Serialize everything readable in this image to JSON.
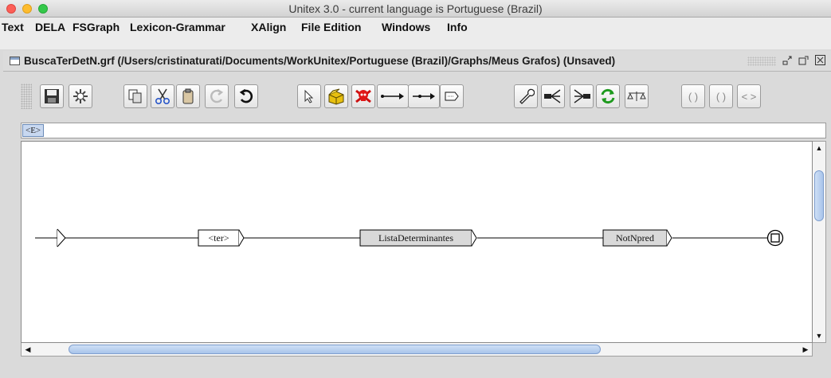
{
  "window": {
    "title": "Unitex 3.0 - current language is Portuguese (Brazil)"
  },
  "menubar": {
    "items": [
      {
        "label": "Text"
      },
      {
        "label": "DELA"
      },
      {
        "label": "FSGraph"
      },
      {
        "label": "Lexicon-Grammar"
      },
      {
        "label": "XAlign"
      },
      {
        "label": "File Edition"
      },
      {
        "label": "Windows"
      },
      {
        "label": "Info"
      }
    ]
  },
  "frame": {
    "title": "BuscaTerDetN.grf (/Users/cristinaturati/Documents/WorkUnitex/Portuguese (Brazil)/Graphs/Meus Grafos) (Unsaved)",
    "controls": [
      "iconify-icon",
      "maximize-icon",
      "close-icon"
    ]
  },
  "toolbar": {
    "buttons": [
      {
        "name": "save-button",
        "icon": "floppy-disk-icon"
      },
      {
        "name": "compile-button",
        "icon": "gear-icon"
      },
      {
        "name": "copy-button",
        "icon": "copy-icon"
      },
      {
        "name": "cut-button",
        "icon": "scissors-icon"
      },
      {
        "name": "paste-button",
        "icon": "clipboard-icon"
      },
      {
        "name": "redo-button",
        "icon": "redo-icon",
        "disabled": true
      },
      {
        "name": "undo-button",
        "icon": "undo-icon"
      },
      {
        "name": "select-tool-button",
        "icon": "arrow-pointer-icon"
      },
      {
        "name": "create-box-button",
        "icon": "open-box-icon"
      },
      {
        "name": "kill-box-button",
        "icon": "skull-icon"
      },
      {
        "name": "link-boxes-button",
        "icon": "link-arrow-icon"
      },
      {
        "name": "reverse-link-button",
        "icon": "reverse-link-icon"
      },
      {
        "name": "open-subgraph-button",
        "icon": "subgraph-box-icon"
      },
      {
        "name": "configure-button",
        "icon": "wrench-icon"
      },
      {
        "name": "align-button",
        "icon": "fork-left-icon"
      },
      {
        "name": "merge-button",
        "icon": "fork-right-icon"
      },
      {
        "name": "refresh-button",
        "icon": "refresh-icon"
      },
      {
        "name": "balance-button",
        "icon": "balance-icon"
      },
      {
        "name": "parens-button-1",
        "label": "( )",
        "disabled": true
      },
      {
        "name": "parens-button-2",
        "label": "( )",
        "disabled": true
      },
      {
        "name": "angle-button",
        "label": "< >",
        "disabled": true
      }
    ]
  },
  "token_strip": {
    "value": "<E>"
  },
  "graph": {
    "boxes": [
      {
        "name": "box-ter",
        "label": "<ter>",
        "subgraph": false
      },
      {
        "name": "box-lista-determinantes",
        "label": "ListaDeterminantes",
        "subgraph": true
      },
      {
        "name": "box-notnpred",
        "label": "NotNpred",
        "subgraph": true
      }
    ],
    "colors": {
      "subgraph_fill": "#d9d9d9",
      "line": "#000000"
    }
  },
  "scrollbars": {
    "vertical": {
      "thumb_fraction_start": 0.1,
      "thumb_fraction_size": 0.28
    },
    "horizontal": {
      "thumb_fraction_start": 0.05,
      "thumb_fraction_size": 0.69
    }
  }
}
